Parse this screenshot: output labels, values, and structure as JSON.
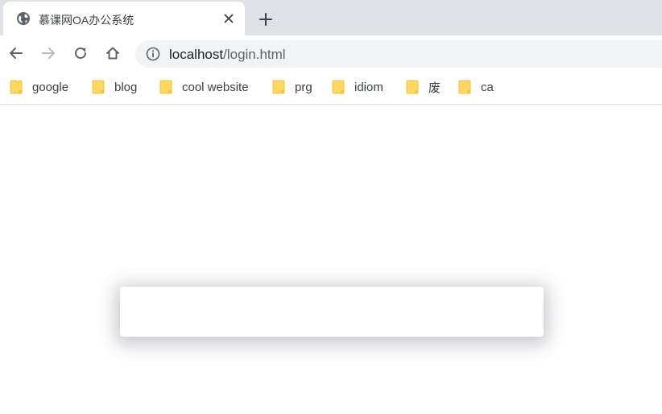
{
  "tab": {
    "title": "慕课网OA办公系统",
    "favicon": "globe-icon",
    "close_icon": "close-icon"
  },
  "new_tab_icon": "plus-icon",
  "toolbar": {
    "back_icon": "back-arrow-icon",
    "forward_icon": "forward-arrow-icon",
    "reload_icon": "reload-icon",
    "home_icon": "home-icon"
  },
  "omnibox": {
    "info_icon": "info-icon",
    "url_host": "localhost",
    "url_path": "/login.html"
  },
  "bookmarks": [
    {
      "label": "google",
      "icon": "folder-icon"
    },
    {
      "label": "blog",
      "icon": "folder-icon"
    },
    {
      "label": "cool website",
      "icon": "folder-icon"
    },
    {
      "label": "prg",
      "icon": "folder-icon"
    },
    {
      "label": "idiom",
      "icon": "folder-icon"
    },
    {
      "label": "废",
      "icon": "folder-icon"
    },
    {
      "label": "ca",
      "icon": "folder-icon"
    }
  ],
  "colors": {
    "tabstrip_bg": "#dee1e6",
    "omnibox_bg": "#f1f3f4",
    "folder_fill": "#fdd663",
    "folder_stroke": "#f5c543"
  }
}
